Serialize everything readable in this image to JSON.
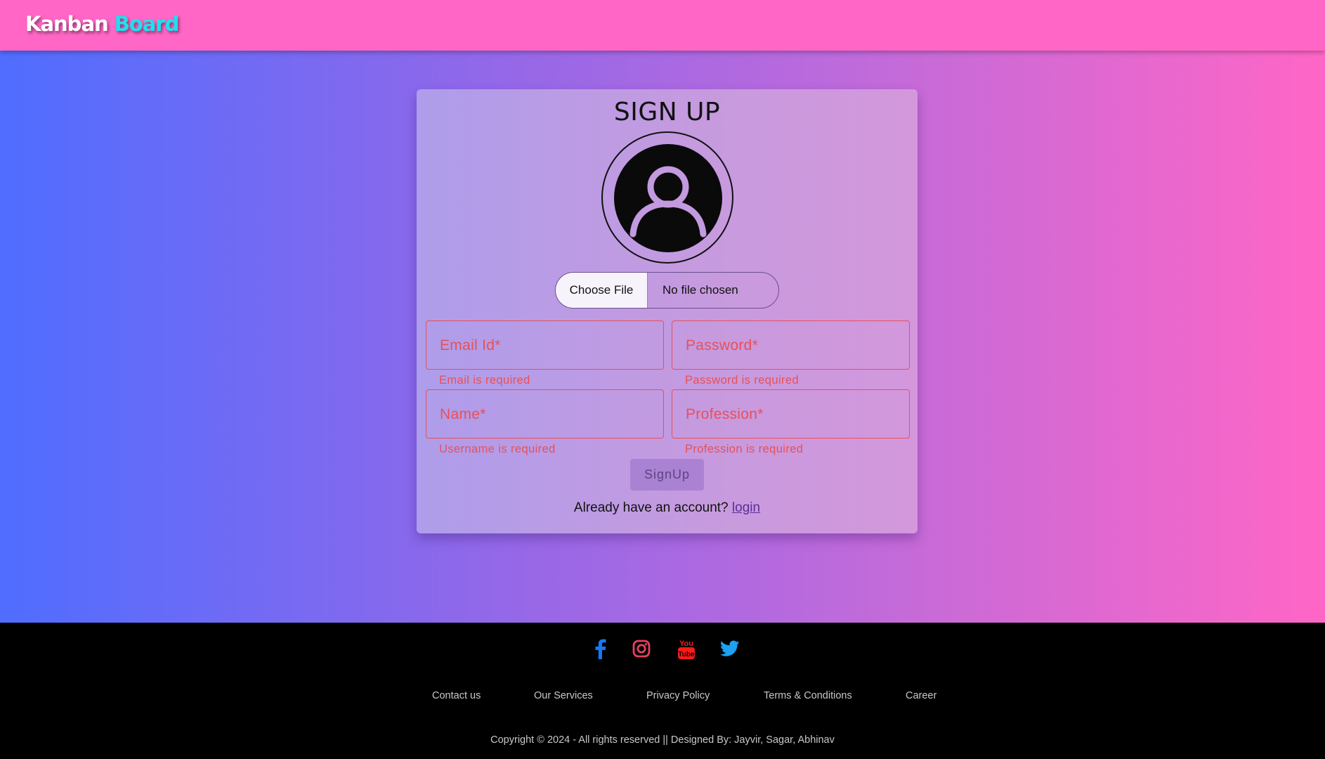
{
  "header": {
    "brand_part1": "Kanban",
    "brand_part2": "Board"
  },
  "signup": {
    "title": "SIGN UP",
    "file_button": "Choose File",
    "file_status": "No file chosen",
    "fields": {
      "email": {
        "placeholder": "Email Id*",
        "error": "Email is required"
      },
      "password": {
        "placeholder": "Password*",
        "error": "Password is required"
      },
      "name": {
        "placeholder": "Name*",
        "error": "Username is required"
      },
      "profession": {
        "placeholder": "Profession*",
        "error": "Profession is required"
      }
    },
    "submit_label": "SignUp",
    "already_text": "Already have an account?",
    "login_link": "login"
  },
  "footer": {
    "social": [
      "facebook-icon",
      "instagram-icon",
      "youtube-icon",
      "twitter-icon"
    ],
    "links": [
      "Contact us",
      "Our Services",
      "Privacy Policy",
      "Terms & Conditions",
      "Career"
    ],
    "copyright": "Copyright © 2024 - All rights reserved || Designed By: Jayvir, Sagar, Abhinav"
  },
  "colors": {
    "header_bg": "#ff66c6",
    "brand_accent": "#1ee0ee",
    "error": "#e8505a",
    "facebook": "#1877f2",
    "instagram": "#e4405f",
    "youtube": "#ff0000",
    "twitter": "#1da1f2"
  }
}
